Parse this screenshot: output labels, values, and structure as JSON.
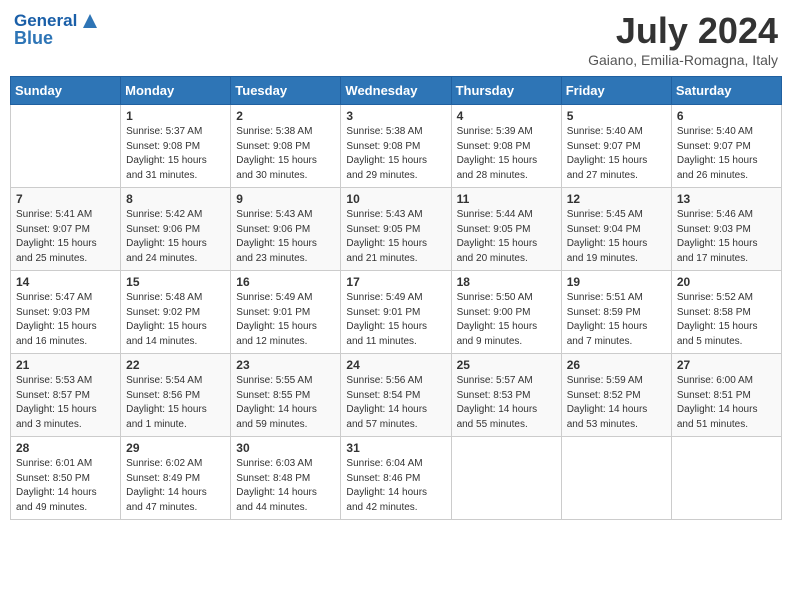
{
  "header": {
    "logo_general": "General",
    "logo_blue": "Blue",
    "month_year": "July 2024",
    "location": "Gaiano, Emilia-Romagna, Italy"
  },
  "days_of_week": [
    "Sunday",
    "Monday",
    "Tuesday",
    "Wednesday",
    "Thursday",
    "Friday",
    "Saturday"
  ],
  "weeks": [
    [
      {
        "day": "",
        "info": ""
      },
      {
        "day": "1",
        "info": "Sunrise: 5:37 AM\nSunset: 9:08 PM\nDaylight: 15 hours\nand 31 minutes."
      },
      {
        "day": "2",
        "info": "Sunrise: 5:38 AM\nSunset: 9:08 PM\nDaylight: 15 hours\nand 30 minutes."
      },
      {
        "day": "3",
        "info": "Sunrise: 5:38 AM\nSunset: 9:08 PM\nDaylight: 15 hours\nand 29 minutes."
      },
      {
        "day": "4",
        "info": "Sunrise: 5:39 AM\nSunset: 9:08 PM\nDaylight: 15 hours\nand 28 minutes."
      },
      {
        "day": "5",
        "info": "Sunrise: 5:40 AM\nSunset: 9:07 PM\nDaylight: 15 hours\nand 27 minutes."
      },
      {
        "day": "6",
        "info": "Sunrise: 5:40 AM\nSunset: 9:07 PM\nDaylight: 15 hours\nand 26 minutes."
      }
    ],
    [
      {
        "day": "7",
        "info": "Sunrise: 5:41 AM\nSunset: 9:07 PM\nDaylight: 15 hours\nand 25 minutes."
      },
      {
        "day": "8",
        "info": "Sunrise: 5:42 AM\nSunset: 9:06 PM\nDaylight: 15 hours\nand 24 minutes."
      },
      {
        "day": "9",
        "info": "Sunrise: 5:43 AM\nSunset: 9:06 PM\nDaylight: 15 hours\nand 23 minutes."
      },
      {
        "day": "10",
        "info": "Sunrise: 5:43 AM\nSunset: 9:05 PM\nDaylight: 15 hours\nand 21 minutes."
      },
      {
        "day": "11",
        "info": "Sunrise: 5:44 AM\nSunset: 9:05 PM\nDaylight: 15 hours\nand 20 minutes."
      },
      {
        "day": "12",
        "info": "Sunrise: 5:45 AM\nSunset: 9:04 PM\nDaylight: 15 hours\nand 19 minutes."
      },
      {
        "day": "13",
        "info": "Sunrise: 5:46 AM\nSunset: 9:03 PM\nDaylight: 15 hours\nand 17 minutes."
      }
    ],
    [
      {
        "day": "14",
        "info": "Sunrise: 5:47 AM\nSunset: 9:03 PM\nDaylight: 15 hours\nand 16 minutes."
      },
      {
        "day": "15",
        "info": "Sunrise: 5:48 AM\nSunset: 9:02 PM\nDaylight: 15 hours\nand 14 minutes."
      },
      {
        "day": "16",
        "info": "Sunrise: 5:49 AM\nSunset: 9:01 PM\nDaylight: 15 hours\nand 12 minutes."
      },
      {
        "day": "17",
        "info": "Sunrise: 5:49 AM\nSunset: 9:01 PM\nDaylight: 15 hours\nand 11 minutes."
      },
      {
        "day": "18",
        "info": "Sunrise: 5:50 AM\nSunset: 9:00 PM\nDaylight: 15 hours\nand 9 minutes."
      },
      {
        "day": "19",
        "info": "Sunrise: 5:51 AM\nSunset: 8:59 PM\nDaylight: 15 hours\nand 7 minutes."
      },
      {
        "day": "20",
        "info": "Sunrise: 5:52 AM\nSunset: 8:58 PM\nDaylight: 15 hours\nand 5 minutes."
      }
    ],
    [
      {
        "day": "21",
        "info": "Sunrise: 5:53 AM\nSunset: 8:57 PM\nDaylight: 15 hours\nand 3 minutes."
      },
      {
        "day": "22",
        "info": "Sunrise: 5:54 AM\nSunset: 8:56 PM\nDaylight: 15 hours\nand 1 minute."
      },
      {
        "day": "23",
        "info": "Sunrise: 5:55 AM\nSunset: 8:55 PM\nDaylight: 14 hours\nand 59 minutes."
      },
      {
        "day": "24",
        "info": "Sunrise: 5:56 AM\nSunset: 8:54 PM\nDaylight: 14 hours\nand 57 minutes."
      },
      {
        "day": "25",
        "info": "Sunrise: 5:57 AM\nSunset: 8:53 PM\nDaylight: 14 hours\nand 55 minutes."
      },
      {
        "day": "26",
        "info": "Sunrise: 5:59 AM\nSunset: 8:52 PM\nDaylight: 14 hours\nand 53 minutes."
      },
      {
        "day": "27",
        "info": "Sunrise: 6:00 AM\nSunset: 8:51 PM\nDaylight: 14 hours\nand 51 minutes."
      }
    ],
    [
      {
        "day": "28",
        "info": "Sunrise: 6:01 AM\nSunset: 8:50 PM\nDaylight: 14 hours\nand 49 minutes."
      },
      {
        "day": "29",
        "info": "Sunrise: 6:02 AM\nSunset: 8:49 PM\nDaylight: 14 hours\nand 47 minutes."
      },
      {
        "day": "30",
        "info": "Sunrise: 6:03 AM\nSunset: 8:48 PM\nDaylight: 14 hours\nand 44 minutes."
      },
      {
        "day": "31",
        "info": "Sunrise: 6:04 AM\nSunset: 8:46 PM\nDaylight: 14 hours\nand 42 minutes."
      },
      {
        "day": "",
        "info": ""
      },
      {
        "day": "",
        "info": ""
      },
      {
        "day": "",
        "info": ""
      }
    ]
  ]
}
